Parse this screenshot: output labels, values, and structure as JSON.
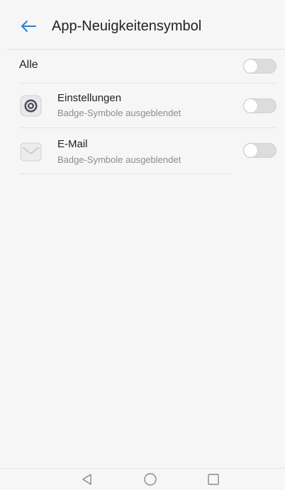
{
  "header": {
    "title": "App-Neuigkeitensymbol",
    "back_icon": "arrow-left-icon",
    "accent": "#2a7fd4"
  },
  "all_row": {
    "label": "Alle",
    "toggle_on": false
  },
  "apps": [
    {
      "name": "Einstellungen",
      "subtitle": "Badge-Symbole ausgeblendet",
      "icon": "settings-gear-icon",
      "toggle_on": false
    },
    {
      "name": "E-Mail",
      "subtitle": "Badge-Symbole ausgeblendet",
      "icon": "mail-envelope-icon",
      "toggle_on": false
    }
  ],
  "navbar": {
    "back": "triangle-back-icon",
    "home": "circle-home-icon",
    "recents": "square-recents-icon"
  }
}
